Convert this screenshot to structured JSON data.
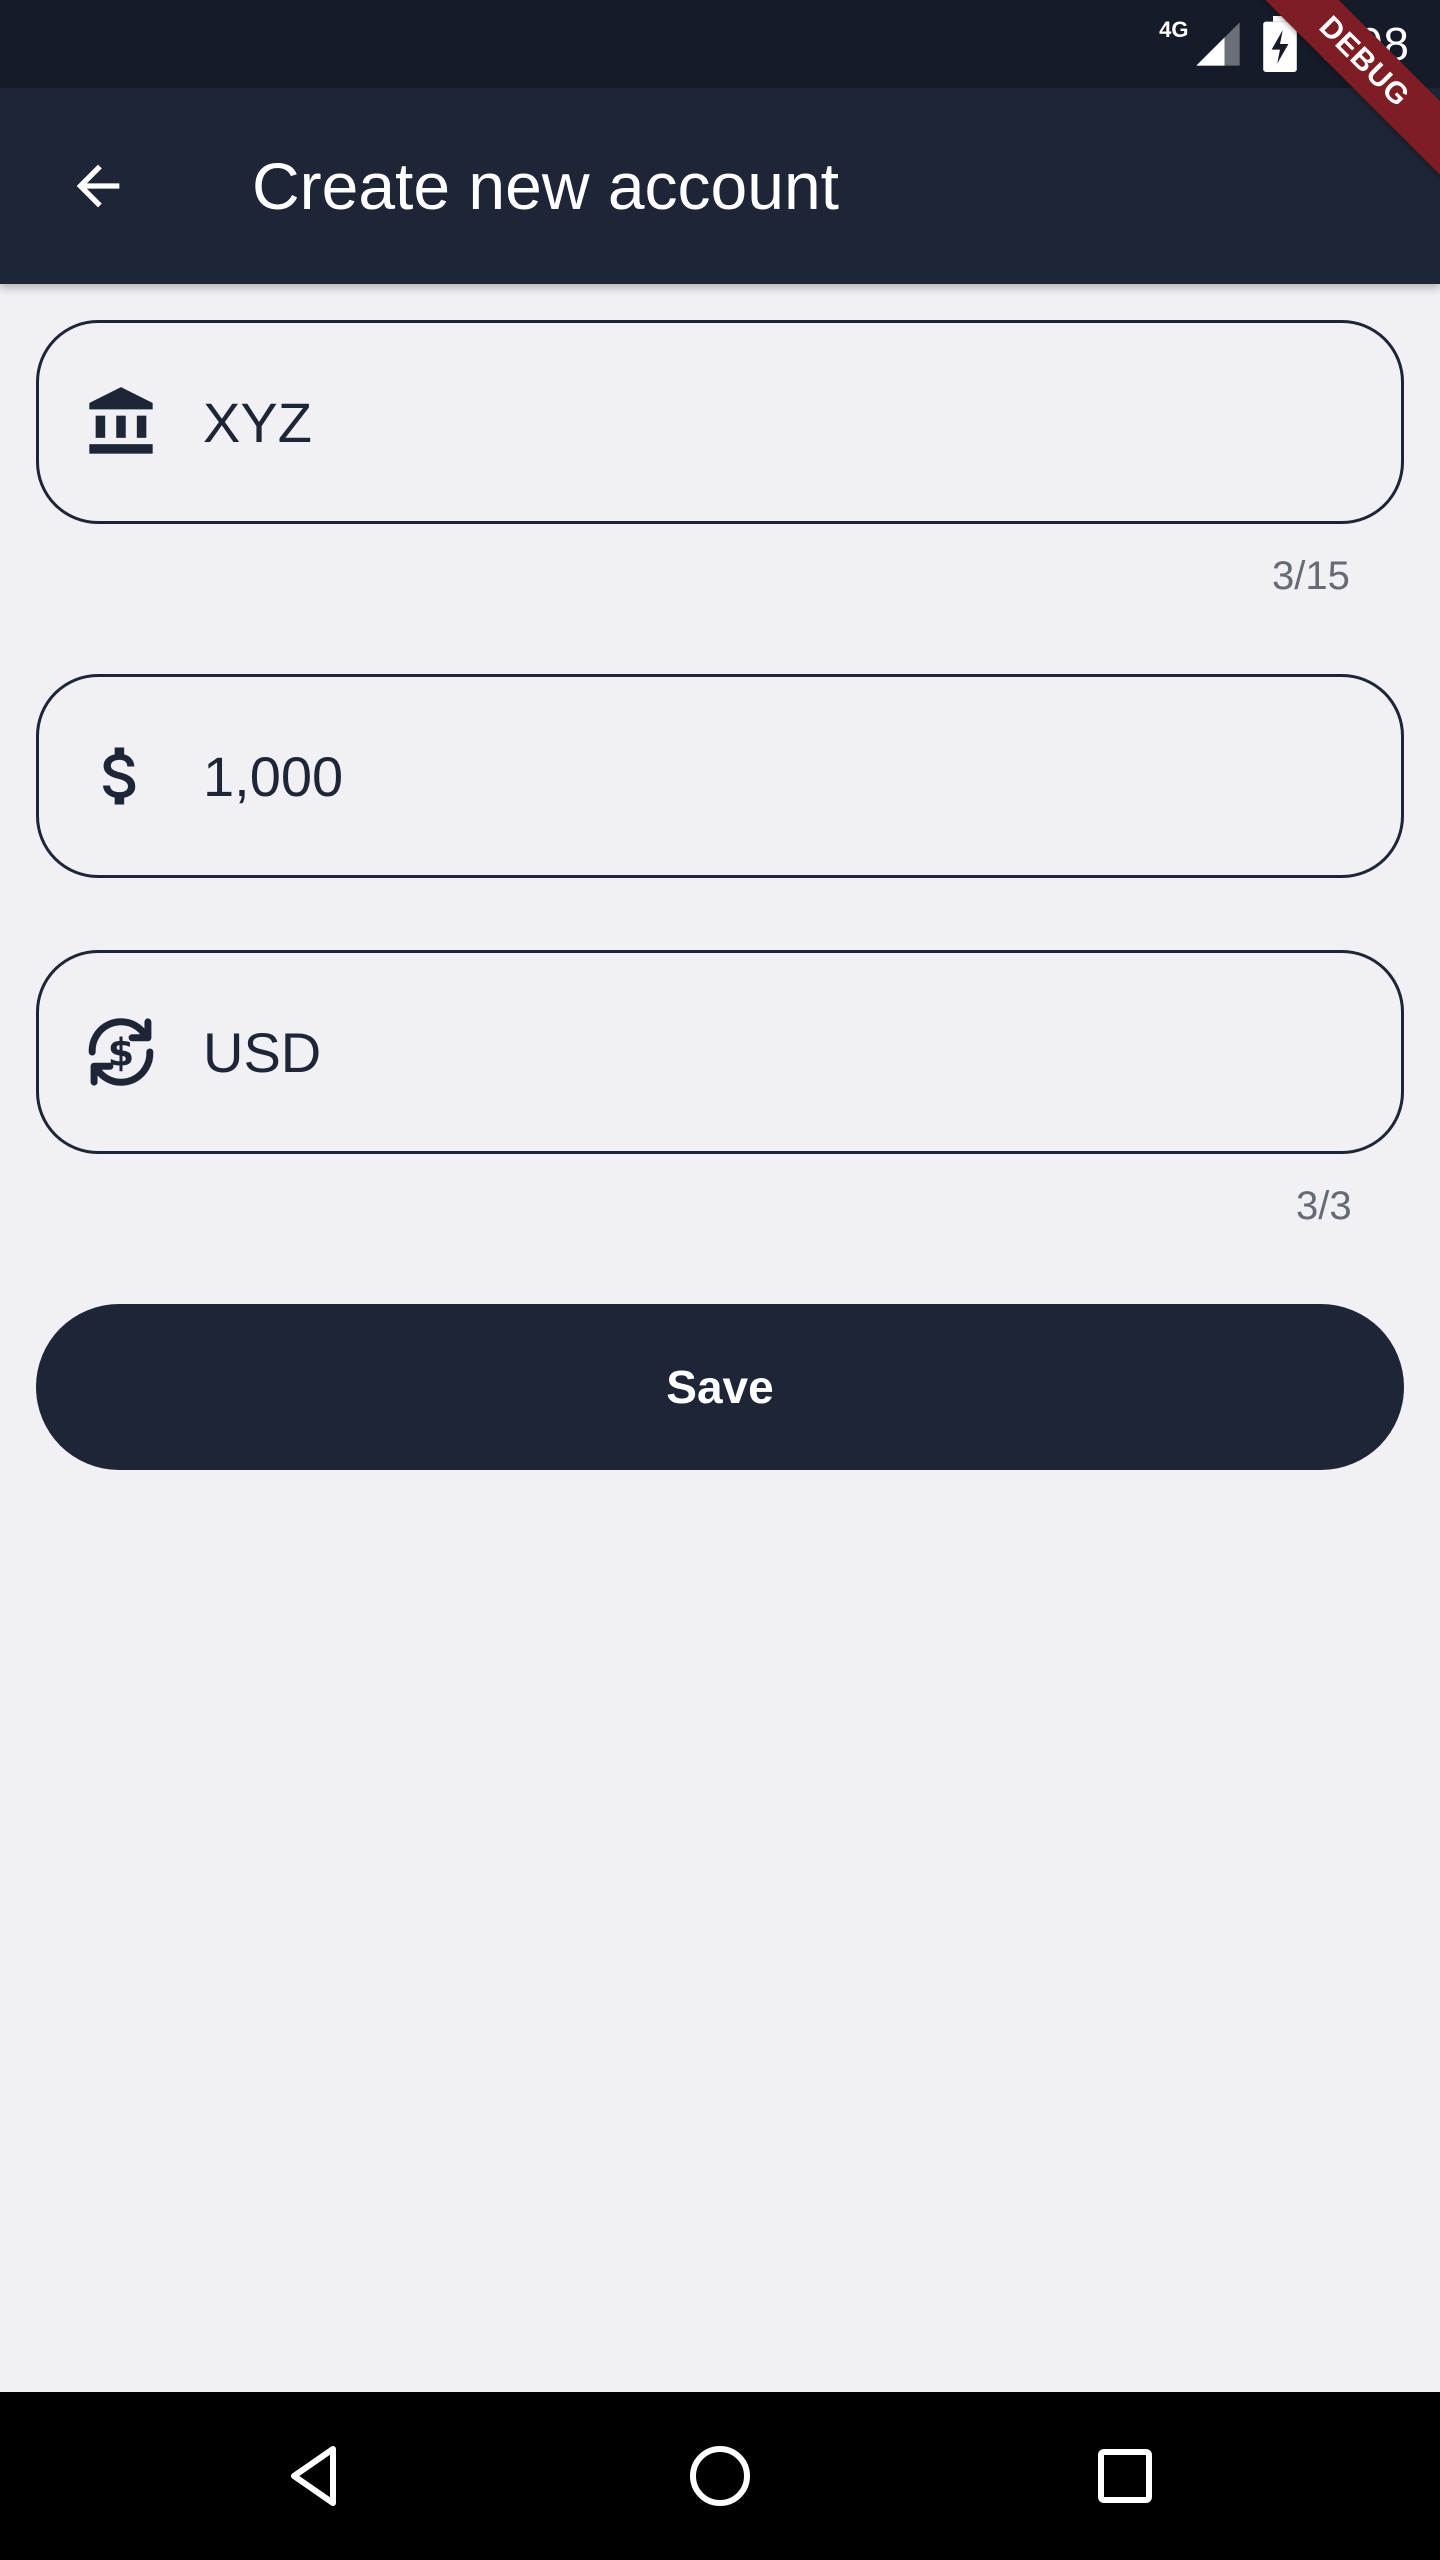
{
  "status_bar": {
    "network": "4G",
    "time": "7:08",
    "debug_label": "DEBUG"
  },
  "app_bar": {
    "title": "Create new account",
    "back_icon": "arrow-back-icon"
  },
  "form": {
    "account_name": {
      "icon": "bank-icon",
      "value": "XYZ",
      "counter": "3/15"
    },
    "balance": {
      "icon": "dollar-icon",
      "value": "1,000"
    },
    "currency": {
      "icon": "currency-exchange-icon",
      "value": "USD",
      "counter": "3/3"
    },
    "save_label": "Save"
  },
  "nav_bar": {
    "back": "triangle-back-icon",
    "home": "circle-home-icon",
    "recents": "square-recents-icon"
  },
  "colors": {
    "primary": "#1e2536",
    "background": "#f0f0f5",
    "status_bar": "#151b28",
    "debug_ribbon": "#7e1d24"
  }
}
